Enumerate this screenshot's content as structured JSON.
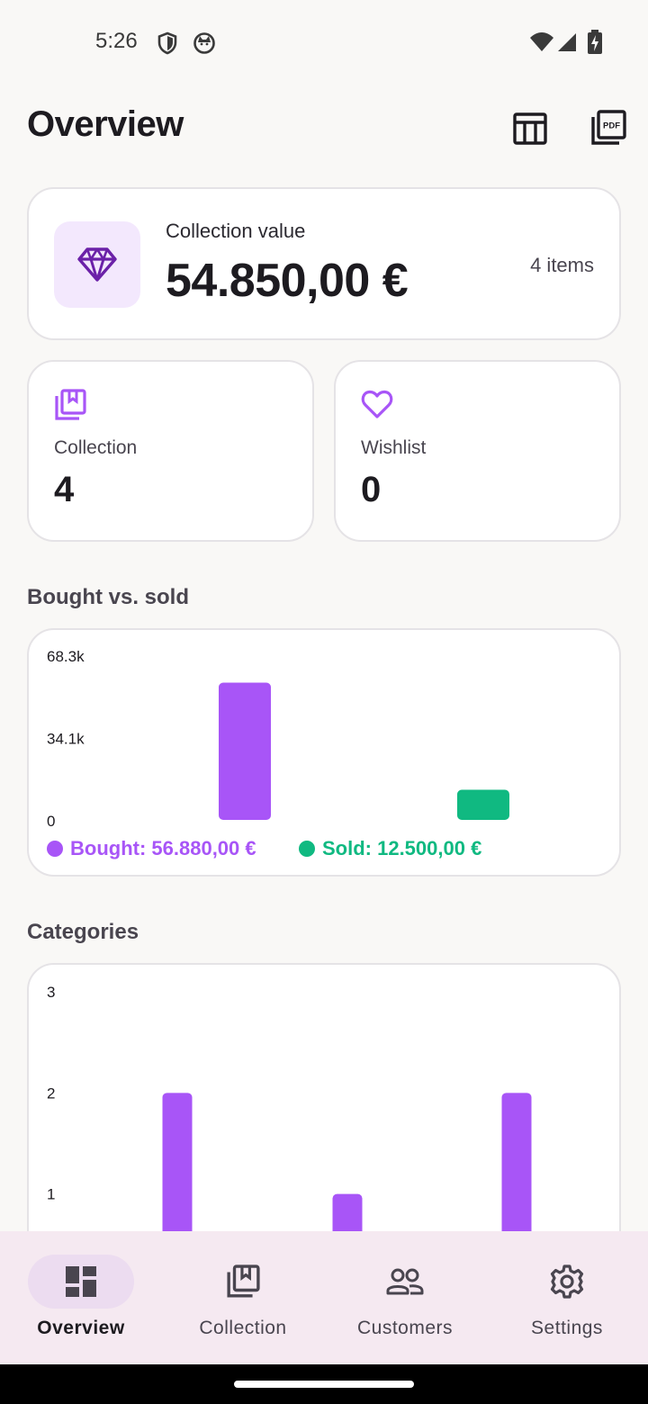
{
  "status_bar": {
    "time": "5:26",
    "icons": [
      "shield-icon",
      "cat-icon",
      "wifi-icon",
      "signal-icon",
      "battery-charging-icon"
    ]
  },
  "header": {
    "title": "Overview",
    "actions": [
      "table-icon",
      "pdf-icon"
    ]
  },
  "value_card": {
    "label": "Collection value",
    "amount": "54.850,00 €",
    "items": "4 items",
    "icon": "diamond-icon"
  },
  "stats": {
    "collection": {
      "label": "Collection",
      "value": "4",
      "icon": "collection-icon"
    },
    "wishlist": {
      "label": "Wishlist",
      "value": "0",
      "icon": "heart-icon"
    }
  },
  "sections": {
    "bought_vs_sold": "Bought vs. sold",
    "categories": "Categories"
  },
  "legend": {
    "bought": "Bought: 56.880,00 €",
    "sold": "Sold: 12.500,00 €"
  },
  "colors": {
    "accent": "#a855f7",
    "sold": "#10b981",
    "icon_purple": "#6b21a8"
  },
  "chart_data": [
    {
      "type": "bar",
      "categories": [
        "Bought",
        "Sold"
      ],
      "values": [
        56880,
        12500
      ],
      "colors": [
        "#a855f7",
        "#10b981"
      ],
      "ylim": [
        0,
        68256
      ],
      "yticks": [
        "0",
        "34.1k",
        "68.3k"
      ],
      "ytick_values": [
        0,
        34128,
        68256
      ]
    },
    {
      "type": "bar",
      "categories": [
        "",
        "",
        ""
      ],
      "values": [
        2,
        1,
        2
      ],
      "ylim": [
        0,
        3
      ],
      "yticks": [
        "1",
        "2",
        "3"
      ],
      "ytick_values": [
        1,
        2,
        3
      ]
    }
  ],
  "nav": {
    "items": [
      {
        "label": "Overview",
        "icon": "dashboard-icon",
        "active": true
      },
      {
        "label": "Collection",
        "icon": "collection-icon",
        "active": false
      },
      {
        "label": "Customers",
        "icon": "people-icon",
        "active": false
      },
      {
        "label": "Settings",
        "icon": "gear-icon",
        "active": false
      }
    ]
  }
}
